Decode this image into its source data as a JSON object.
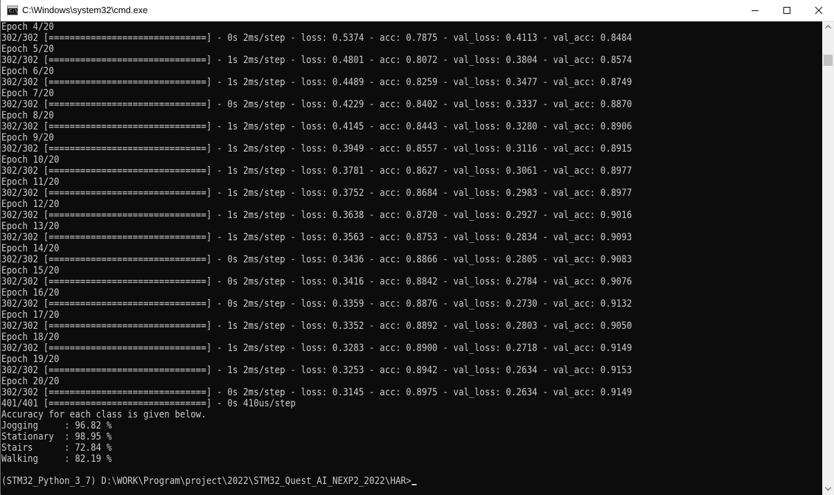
{
  "window": {
    "title": "C:\\Windows\\system32\\cmd.exe",
    "icon": "cmd-prompt-icon",
    "controls": {
      "minimize": "minimize-icon",
      "maximize": "maximize-icon",
      "close": "close-icon"
    }
  },
  "console": {
    "lines": [
      "Epoch 4/20",
      "302/302 [==============================] - 0s 2ms/step - loss: 0.5374 - acc: 0.7875 - val_loss: 0.4113 - val_acc: 0.8484",
      "Epoch 5/20",
      "302/302 [==============================] - 1s 2ms/step - loss: 0.4801 - acc: 0.8072 - val_loss: 0.3804 - val_acc: 0.8574",
      "Epoch 6/20",
      "302/302 [==============================] - 1s 2ms/step - loss: 0.4489 - acc: 0.8259 - val_loss: 0.3477 - val_acc: 0.8749",
      "Epoch 7/20",
      "302/302 [==============================] - 0s 2ms/step - loss: 0.4229 - acc: 0.8402 - val_loss: 0.3337 - val_acc: 0.8870",
      "Epoch 8/20",
      "302/302 [==============================] - 1s 2ms/step - loss: 0.4145 - acc: 0.8443 - val_loss: 0.3280 - val_acc: 0.8906",
      "Epoch 9/20",
      "302/302 [==============================] - 1s 2ms/step - loss: 0.3949 - acc: 0.8557 - val_loss: 0.3116 - val_acc: 0.8915",
      "Epoch 10/20",
      "302/302 [==============================] - 1s 2ms/step - loss: 0.3781 - acc: 0.8627 - val_loss: 0.3061 - val_acc: 0.8977",
      "Epoch 11/20",
      "302/302 [==============================] - 1s 2ms/step - loss: 0.3752 - acc: 0.8684 - val_loss: 0.2983 - val_acc: 0.8977",
      "Epoch 12/20",
      "302/302 [==============================] - 1s 2ms/step - loss: 0.3638 - acc: 0.8720 - val_loss: 0.2927 - val_acc: 0.9016",
      "Epoch 13/20",
      "302/302 [==============================] - 1s 2ms/step - loss: 0.3563 - acc: 0.8753 - val_loss: 0.2834 - val_acc: 0.9093",
      "Epoch 14/20",
      "302/302 [==============================] - 0s 2ms/step - loss: 0.3436 - acc: 0.8866 - val_loss: 0.2805 - val_acc: 0.9083",
      "Epoch 15/20",
      "302/302 [==============================] - 0s 2ms/step - loss: 0.3416 - acc: 0.8842 - val_loss: 0.2784 - val_acc: 0.9076",
      "Epoch 16/20",
      "302/302 [==============================] - 0s 2ms/step - loss: 0.3359 - acc: 0.8876 - val_loss: 0.2730 - val_acc: 0.9132",
      "Epoch 17/20",
      "302/302 [==============================] - 1s 2ms/step - loss: 0.3352 - acc: 0.8892 - val_loss: 0.2803 - val_acc: 0.9050",
      "Epoch 18/20",
      "302/302 [==============================] - 1s 2ms/step - loss: 0.3283 - acc: 0.8900 - val_loss: 0.2718 - val_acc: 0.9149",
      "Epoch 19/20",
      "302/302 [==============================] - 1s 2ms/step - loss: 0.3253 - acc: 0.8942 - val_loss: 0.2634 - val_acc: 0.9153",
      "Epoch 20/20",
      "302/302 [==============================] - 0s 2ms/step - loss: 0.3145 - acc: 0.8975 - val_loss: 0.2634 - val_acc: 0.9149",
      "401/401 [==============================] - 0s 410us/step",
      "Accuracy for each class is given below.",
      "Jogging     : 96.82 %",
      "Stationary  : 98.95 %",
      "Stairs      : 72.84 %",
      "Walking     : 82.19 %",
      ""
    ],
    "prompt": "(STM32_Python_3_7) D:\\WORK\\Program\\project\\2022\\STM32_Quest_AI_NEXP2_2022\\HAR>"
  },
  "colors": {
    "console_bg": "#0c0c0c",
    "console_fg": "#cccccc",
    "titlebar_bg": "#ffffff",
    "scrollbar_bg": "#f0f0f0",
    "scroll_thumb": "#c2c2c2"
  }
}
